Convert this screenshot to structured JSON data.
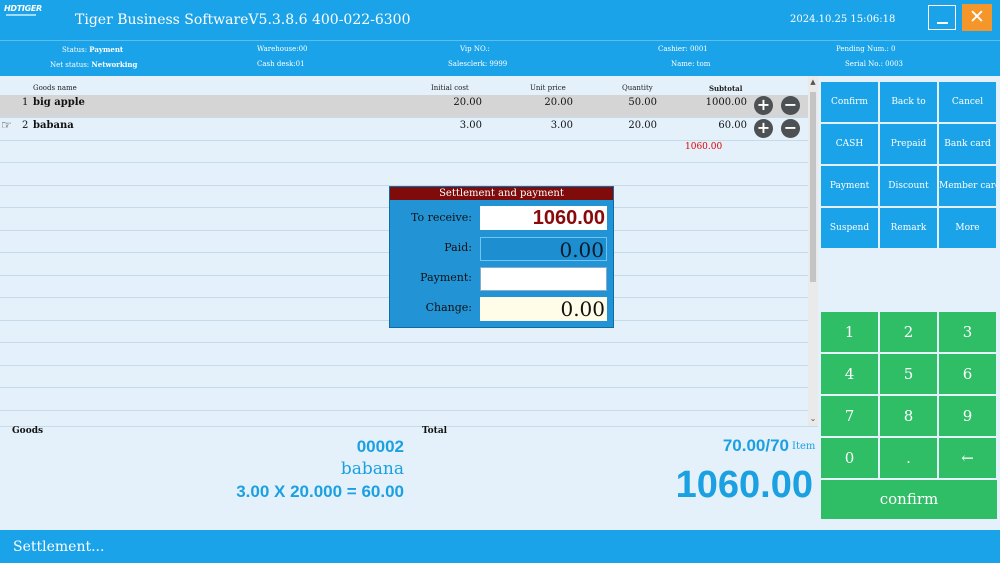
{
  "titlebar": {
    "logo": "HDTIGER",
    "title": "Tiger Business SoftwareV5.3.8.6 400-022-6300",
    "datetime": "2024.10.25 15:06:18"
  },
  "info": {
    "status_label": "Status:",
    "status_value": "Payment",
    "net_label": "Net status:",
    "net_value": "Networking",
    "warehouse": "Warehouse:00",
    "cash_desk": "Cash desk:01",
    "vip": "Vip NO.:",
    "salesclerk": "Salesclerk: 9999",
    "cashier": "Cashier: 0001",
    "name": "Name: tom",
    "pending": "Pending Num.: 0",
    "serial": "Serial No.: 0003"
  },
  "table": {
    "headers": [
      "Goods name",
      "Initial cost",
      "Unit price",
      "Quantity",
      "Subtotal"
    ],
    "rows": [
      {
        "no": "1",
        "name": "big apple",
        "cost": "20.00",
        "price": "20.00",
        "qty": "50.00",
        "subtotal": "1000.00"
      },
      {
        "no": "2",
        "name": "babana",
        "cost": "3.00",
        "price": "3.00",
        "qty": "20.00",
        "subtotal": "60.00"
      }
    ],
    "total": "1060.00",
    "plus": "+",
    "minus": "−",
    "pointer": "☞"
  },
  "dialog": {
    "title": "Settlement and payment",
    "to_receive_label": "To receive:",
    "to_receive": "1060.00",
    "paid_label": "Paid:",
    "paid": "0.00",
    "payment_label": "Payment:",
    "payment": "",
    "change_label": "Change:",
    "change": "0.00"
  },
  "summary": {
    "goods_label": "Goods",
    "total_label": "Total",
    "code": "00002",
    "item_name": "babana",
    "calc": "3.00 X 20.000 = 60.00",
    "count": "70.00/70",
    "count_unit": "Item",
    "grand_total": "1060.00"
  },
  "functions": [
    "Confirm",
    "Back to",
    "Cancel",
    "CASH",
    "Prepaid",
    "Bank card",
    "Payment",
    "Discount",
    "Member card",
    "Suspend",
    "Remark",
    "More"
  ],
  "keypad": [
    "1",
    "2",
    "3",
    "4",
    "5",
    "6",
    "7",
    "8",
    "9",
    "0",
    ".",
    "←"
  ],
  "confirm_label": "confirm",
  "status": "Settlement...",
  "icons": {
    "minimize": "minimize-icon",
    "close": "close-icon",
    "scroll_up": "scroll-up-icon",
    "scroll_down": "scroll-down-icon"
  },
  "colors": {
    "primary": "#1aa3e8",
    "keypad": "#2fbe65",
    "close": "#f5962a",
    "dialog_title": "#7f0b0b",
    "total_red": "#e00000"
  }
}
